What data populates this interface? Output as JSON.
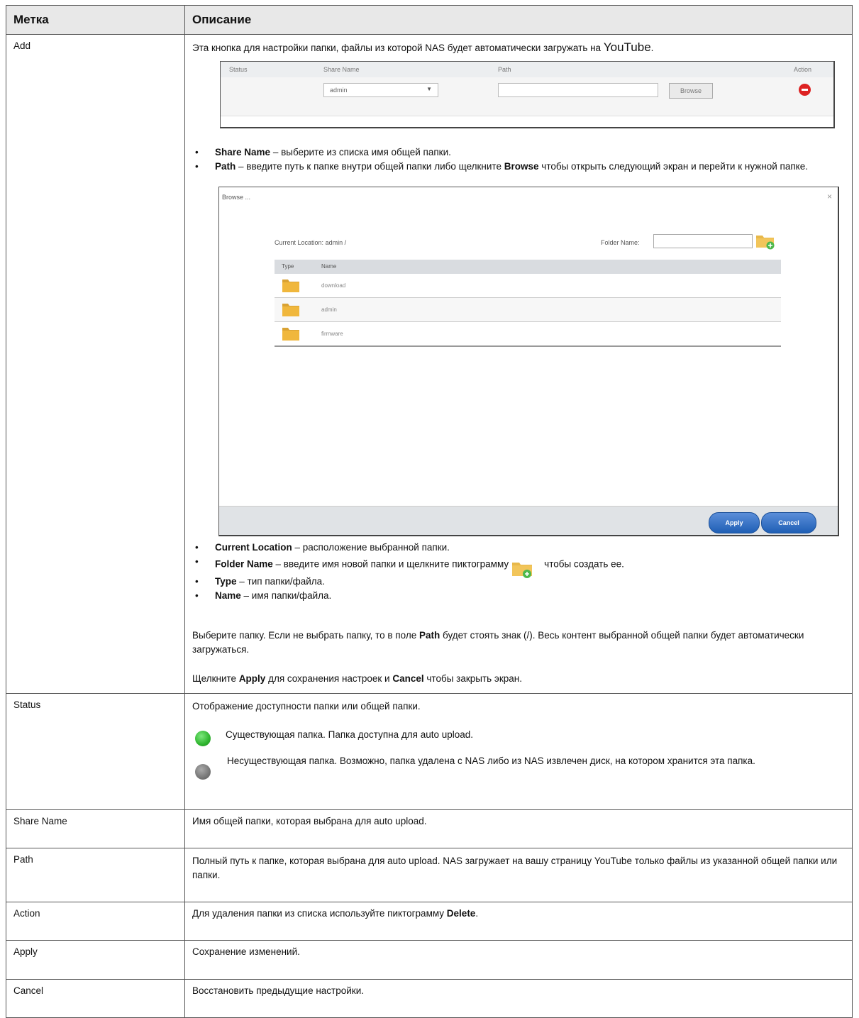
{
  "header": {
    "col1": "Метка",
    "col2": "Описание"
  },
  "add": {
    "label": "Add",
    "intro": "Эта кнопка для настройки папки, файлы из которой NAS будет автоматически загружать на",
    "intro_brand": "YouTube",
    "intro_end": ".",
    "share_screen": {
      "col_status": "Status",
      "col_share": "Share Name",
      "col_path": "Path",
      "col_action": "Action",
      "share_value": "admin",
      "browse_button": "Browse"
    },
    "bullets1": [
      {
        "term": "Share Name",
        "text": "– выберите из списка имя общей папки."
      },
      {
        "term": "Path",
        "text": "– введите путь к папке внутри общей папки либо щелкните",
        "term2": "Browse",
        "text2": "чтобы открыть следующий экран и перейти к нужной папке."
      }
    ],
    "browse_dialog": {
      "title": "Browse ...",
      "close": "×",
      "current_location_label": "Current Location:",
      "current_location_value": "admin /",
      "folder_name_label": "Folder Name:",
      "col_type": "Type",
      "col_name": "Name",
      "rows": [
        "download",
        "admin",
        "firmware"
      ],
      "apply_button": "Apply",
      "cancel_button": "Cancel"
    },
    "bullets2": [
      {
        "term": "Current Location",
        "text": "– расположение выбранной папки."
      },
      {
        "term": "Folder Name",
        "text": "– введите имя новой папки и щелкните пиктограмму",
        "text2": "чтобы создать ее."
      },
      {
        "term": "Type",
        "text": "– тип папки/файла."
      },
      {
        "term": "Name",
        "text": "– имя папки/файла."
      }
    ],
    "para1_a": "Выберите папку. Если не выбрать папку, то в поле",
    "para1_term": "Path",
    "para1_b": "будет стоять знак (/). Весь контент выбранной общей папки будет автоматически загружаться.",
    "para2_a": "Щелкните",
    "para2_term1": "Apply",
    "para2_b": "для сохранения настроек и",
    "para2_term2": "Cancel",
    "para2_c": "чтобы закрыть экран."
  },
  "status": {
    "label": "Status",
    "intro": "Отображение доступности папки или общей папки.",
    "green_text": "Существующая папка. Папка доступна для auto upload.",
    "gray_text": "Несуществующая папка. Возможно, папка удалена с NAS либо из NAS извлечен диск, на котором хранится эта папка.",
    "green_color": "#2fb52f",
    "gray_color": "#777777"
  },
  "share_name": {
    "label": "Share Name",
    "text": "Имя общей папки, которая выбрана для auto upload."
  },
  "path": {
    "label": "Path",
    "text": "Полный путь к папке, которая выбрана для auto upload. NAS загружает на вашу страницу YouTube только файлы из указанной общей папки или папки."
  },
  "action": {
    "label": "Action",
    "text_a": "Для удаления папки из списка используйте пиктограмму",
    "term": "Delete",
    "text_b": "."
  },
  "apply": {
    "label": "Apply",
    "text": "Сохранение изменений."
  },
  "cancel": {
    "label": "Cancel",
    "text": "Восстановить предыдущие настройки."
  }
}
